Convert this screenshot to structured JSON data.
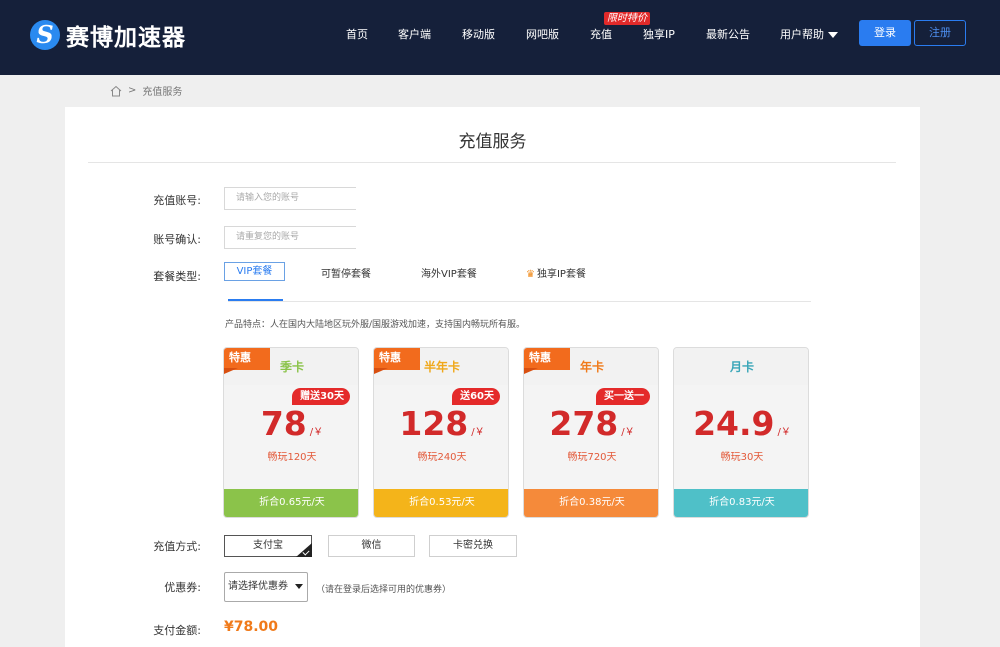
{
  "header": {
    "logo_glyph": "S",
    "logo_text": "赛博加速器",
    "nav": [
      {
        "label": "首页"
      },
      {
        "label": "客户端"
      },
      {
        "label": "移动版"
      },
      {
        "label": "网吧版"
      },
      {
        "label": "充值"
      },
      {
        "label": "独享IP"
      },
      {
        "label": "最新公告"
      },
      {
        "label": "用户帮助"
      }
    ],
    "hot_badge": "限时特价",
    "login": "登录",
    "register": "注册"
  },
  "breadcrumb": {
    "separator": ">",
    "current": "充值服务"
  },
  "page": {
    "title": "充值服务"
  },
  "form": {
    "account_label": "充值账号:",
    "account_placeholder": "请输入您的账号",
    "confirm_label": "账号确认:",
    "confirm_placeholder": "请重复您的账号",
    "package_label": "套餐类型:",
    "tabs": [
      "VIP套餐",
      "可暂停套餐",
      "海外VIP套餐",
      "独享IP套餐"
    ],
    "tab_icon": "crown-icon",
    "feature": "产品特点：人在国内大陆地区玩外服/国服游戏加速，支持国内畅玩所有服。",
    "pay_label": "充值方式:",
    "pay_methods": [
      "支付宝",
      "微信",
      "卡密兑换"
    ],
    "coupon_label": "优惠券:",
    "coupon_selected": "请选择优惠券",
    "coupon_hint": "（请在登录后选择可用的优惠券）",
    "amount_label": "支付金额:",
    "amount": "¥78.00"
  },
  "cards": [
    {
      "promo": "特惠",
      "name": "季卡",
      "bonus": "赠送30天",
      "price": "78",
      "unit": "/￥",
      "duration": "畅玩120天",
      "daily": "折合0.65元/天",
      "name_color": "#8bc34a",
      "foot_color": "#8bc34a"
    },
    {
      "promo": "特惠",
      "name": "半年卡",
      "bonus": "送60天",
      "price": "128",
      "unit": "/￥",
      "duration": "畅玩240天",
      "daily": "折合0.53元/天",
      "name_color": "#f0a81a",
      "foot_color": "#f4b41a"
    },
    {
      "promo": "特惠",
      "name": "年卡",
      "bonus": "买一送一",
      "price": "278",
      "unit": "/￥",
      "duration": "畅玩720天",
      "daily": "折合0.38元/天",
      "name_color": "#f07a1a",
      "foot_color": "#f58a3a"
    },
    {
      "promo": "",
      "name": "月卡",
      "bonus": "",
      "price": "24.9",
      "unit": "/￥",
      "duration": "畅玩30天",
      "daily": "折合0.83元/天",
      "name_color": "#3aa6b8",
      "foot_color": "#4fc0c8"
    }
  ]
}
